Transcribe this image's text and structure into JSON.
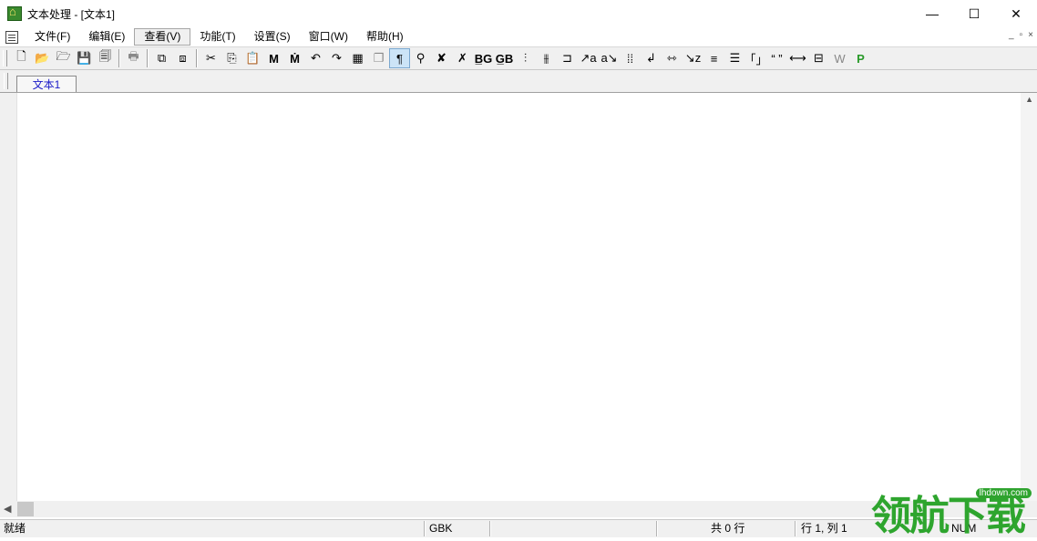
{
  "window": {
    "title": "文本处理 - [文本1]",
    "minimize": "—",
    "maximize": "☐",
    "close": "✕"
  },
  "menubar": {
    "items": [
      "文件(F)",
      "编辑(E)",
      "查看(V)",
      "功能(T)",
      "设置(S)",
      "窗口(W)",
      "帮助(H)"
    ],
    "active_index": 2,
    "mdi_minimize": "_",
    "mdi_restore": "▫",
    "mdi_close": "×"
  },
  "toolbar": {
    "groups": [
      [
        {
          "name": "new-icon",
          "glyph": "🗋"
        },
        {
          "name": "open-icon",
          "glyph": "📂"
        },
        {
          "name": "open-folder-icon",
          "glyph": "🗁"
        },
        {
          "name": "save-icon",
          "glyph": "💾"
        },
        {
          "name": "save-all-icon",
          "glyph": "🗐"
        }
      ],
      [
        {
          "name": "print-icon",
          "glyph": "🖶",
          "gray": true
        }
      ],
      [
        {
          "name": "copy-doc-icon",
          "glyph": "⧉"
        },
        {
          "name": "paste-doc-icon",
          "glyph": "⧈"
        }
      ],
      [
        {
          "name": "cut-icon",
          "glyph": "✂"
        },
        {
          "name": "copy-icon",
          "glyph": "⎘"
        },
        {
          "name": "paste-icon",
          "glyph": "📋"
        },
        {
          "name": "find-icon",
          "glyph": "M",
          "bold": true
        },
        {
          "name": "find-replace-icon",
          "glyph": "Ṁ",
          "bold": true
        },
        {
          "name": "undo-icon",
          "glyph": "↶"
        },
        {
          "name": "redo-icon",
          "glyph": "↷"
        },
        {
          "name": "table-icon",
          "glyph": "▦"
        },
        {
          "name": "clone-icon",
          "glyph": "❐",
          "gray": true
        },
        {
          "name": "paragraph-mark-icon",
          "glyph": "¶",
          "pressed": true
        },
        {
          "name": "link-icon",
          "glyph": "⚲"
        },
        {
          "name": "check-icon",
          "glyph": "✘"
        },
        {
          "name": "spell-icon",
          "glyph": "✗"
        },
        {
          "name": "big5-to-gb-icon",
          "glyph": "B̲G",
          "bold": true
        },
        {
          "name": "gb-to-big5-icon",
          "glyph": "G̲B",
          "bold": true
        },
        {
          "name": "vertical-text-icon",
          "glyph": "⫶"
        },
        {
          "name": "vertical-text-alt-icon",
          "glyph": "⫵"
        },
        {
          "name": "bracket-icon",
          "glyph": "⊐"
        },
        {
          "name": "add-char-icon",
          "glyph": "↗a"
        },
        {
          "name": "remove-char-icon",
          "glyph": "a↘"
        },
        {
          "name": "dots-icon",
          "glyph": "⁞⁞"
        },
        {
          "name": "return-icon",
          "glyph": "↲"
        },
        {
          "name": "wrap-icon",
          "glyph": "⇿"
        },
        {
          "name": "sort-icon",
          "glyph": "↘z"
        },
        {
          "name": "lines-icon",
          "glyph": "≡"
        },
        {
          "name": "indent-icon",
          "glyph": "☰"
        },
        {
          "name": "corner-quote-icon",
          "glyph": "「」"
        },
        {
          "name": "quote-icon",
          "glyph": "“ ”"
        },
        {
          "name": "width-icon",
          "glyph": "⟷"
        },
        {
          "name": "ruler-icon",
          "glyph": "⊟"
        },
        {
          "name": "word-icon",
          "glyph": "W",
          "gray": true
        },
        {
          "name": "p-icon",
          "glyph": "P",
          "green": true
        }
      ]
    ]
  },
  "tabs": {
    "items": [
      "文本1"
    ]
  },
  "editor": {
    "content": ""
  },
  "statusbar": {
    "ready": "就绪",
    "encoding": "GBK",
    "total_lines": "共 0 行",
    "position": "行 1, 列 1",
    "num": "NUM"
  },
  "watermark": {
    "text": "领航下载",
    "domain": "lhdown.com"
  }
}
